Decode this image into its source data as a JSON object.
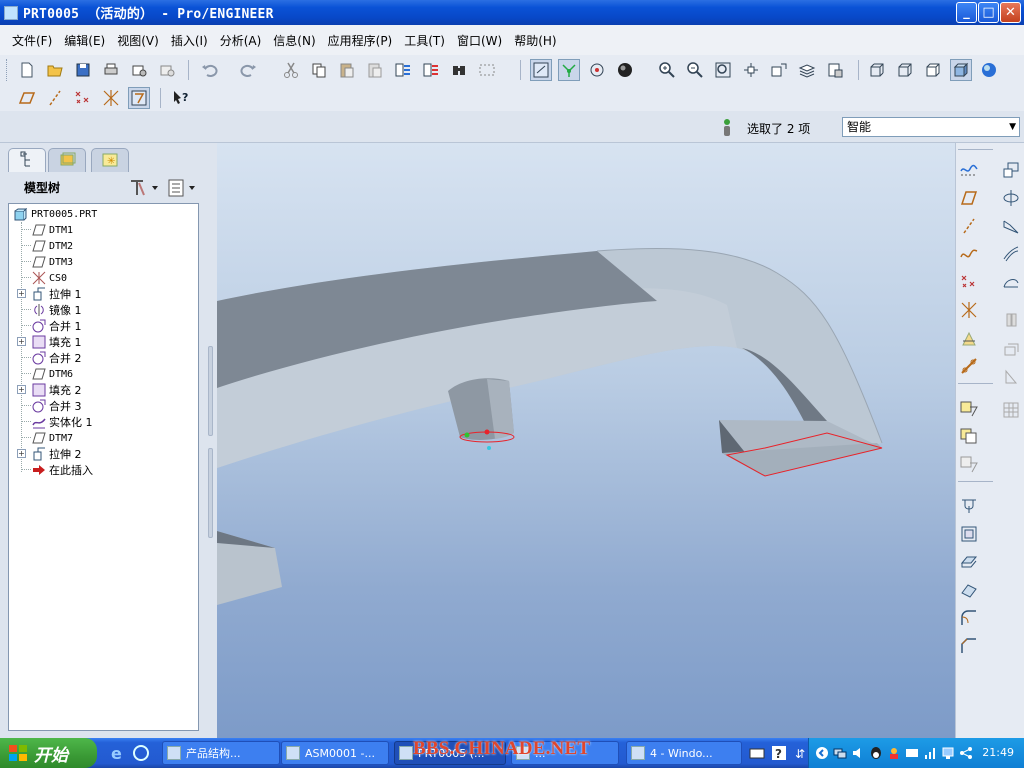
{
  "window": {
    "title": "PRT0005 （活动的） - Pro/ENGINEER",
    "minimize": "_",
    "maximize": "□",
    "close": "✕"
  },
  "menu": [
    {
      "label": "文件(F)"
    },
    {
      "label": "编辑(E)"
    },
    {
      "label": "视图(V)"
    },
    {
      "label": "插入(I)"
    },
    {
      "label": "分析(A)"
    },
    {
      "label": "信息(N)"
    },
    {
      "label": "应用程序(P)"
    },
    {
      "label": "工具(T)"
    },
    {
      "label": "窗口(W)"
    },
    {
      "label": "帮助(H)"
    }
  ],
  "toolbar_icons": [
    "new-icon",
    "open-icon",
    "save-icon",
    "print-icon",
    "send-mail-icon",
    "send-link-icon",
    "undo-icon",
    "redo-icon",
    "cut-icon",
    "copy-icon",
    "paste-icon",
    "paste-special-icon",
    "regenerate-icon",
    "regen-manager-icon",
    "find-icon",
    "select-box-icon",
    "repaint-icon",
    "spin-center-icon",
    "orient-icon",
    "appearance-icon",
    "zoom-in-icon",
    "zoom-out-icon",
    "refit-icon",
    "reorient-icon",
    "saved-views-icon",
    "layers-icon",
    "view-manager-icon",
    "wireframe-icon",
    "hidden-line-icon",
    "no-hidden-icon",
    "shading-icon",
    "enhanced-realism-icon"
  ],
  "toolbar2_icons": [
    "datum-plane-display-icon",
    "datum-axis-display-icon",
    "datum-point-display-icon",
    "csys-display-icon",
    "annotation-display-icon",
    "whats-this-icon"
  ],
  "selection": {
    "status_text": "选取了 2 项",
    "filter_value": "智能"
  },
  "model_tree": {
    "title": "模型树",
    "items": [
      {
        "label": "PRT0005.PRT",
        "icon": "part-icon",
        "indent": 0,
        "expandable": false
      },
      {
        "label": "DTM1",
        "icon": "datum-plane-icon",
        "indent": 1,
        "expandable": false
      },
      {
        "label": "DTM2",
        "icon": "datum-plane-icon",
        "indent": 1,
        "expandable": false
      },
      {
        "label": "DTM3",
        "icon": "datum-plane-icon",
        "indent": 1,
        "expandable": false
      },
      {
        "label": "CS0",
        "icon": "csys-icon",
        "indent": 1,
        "expandable": false
      },
      {
        "label": "拉伸 1",
        "icon": "extrude-icon",
        "indent": 1,
        "expandable": true
      },
      {
        "label": "镜像 1",
        "icon": "mirror-icon",
        "indent": 1,
        "expandable": false
      },
      {
        "label": "合并 1",
        "icon": "merge-icon",
        "indent": 1,
        "expandable": false
      },
      {
        "label": "填充 1",
        "icon": "fill-icon",
        "indent": 1,
        "expandable": true
      },
      {
        "label": "合并 2",
        "icon": "merge-icon",
        "indent": 1,
        "expandable": false
      },
      {
        "label": "DTM6",
        "icon": "datum-plane-icon",
        "indent": 1,
        "expandable": false
      },
      {
        "label": "填充 2",
        "icon": "fill-icon",
        "indent": 1,
        "expandable": true
      },
      {
        "label": "合并 3",
        "icon": "merge-icon",
        "indent": 1,
        "expandable": false
      },
      {
        "label": "实体化 1",
        "icon": "solidify-icon",
        "indent": 1,
        "expandable": false
      },
      {
        "label": "DTM7",
        "icon": "datum-plane-icon",
        "indent": 1,
        "expandable": false
      },
      {
        "label": "拉伸 2",
        "icon": "extrude-icon",
        "indent": 1,
        "expandable": true
      },
      {
        "label": "在此插入",
        "icon": "insert-here-icon",
        "indent": 1,
        "expandable": false
      }
    ]
  },
  "colors": {
    "titlebar": "#0a52d6",
    "model_surface": "#bfcad6",
    "selection_edge": "#e8232a",
    "viewport_top": "#d7e3f1",
    "viewport_bottom": "#7d9bc8"
  },
  "taskbar": {
    "start_label": "开始",
    "tasks": [
      {
        "label": "产品结构..."
      },
      {
        "label": "ASM0001 -..."
      },
      {
        "label": "PRT0005 (..."
      },
      {
        "label": "..."
      },
      {
        "label": "4 - Windo..."
      }
    ],
    "watermark": "BBS.CHINADE.NET",
    "clock": "21:49"
  }
}
